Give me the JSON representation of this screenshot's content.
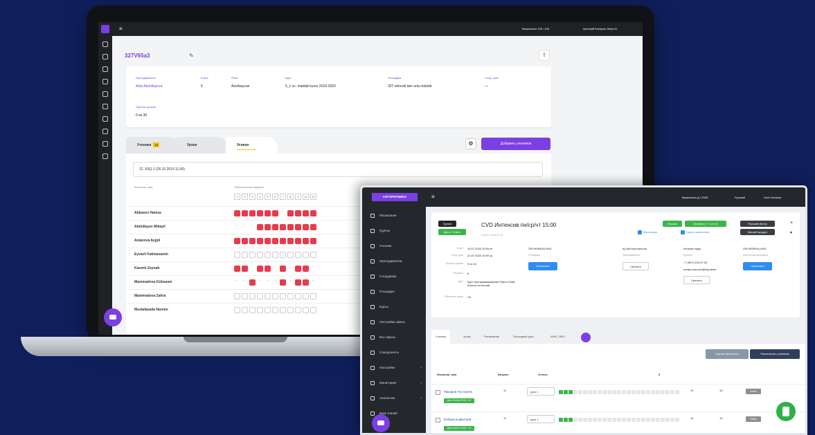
{
  "laptop": {
    "topbar": {
      "menu_icon": "hamburger-icon",
      "branch": "Вершинита 196 / 108",
      "user": "Артемий Бонарик Омер Ш"
    },
    "group_title": "327V65a3",
    "info": [
      {
        "label": "Преподаватель",
        "value": "Aida Abdullayeva",
        "link": true
      },
      {
        "label": "Класс",
        "value": "5",
        "link": false
      },
      {
        "label": "Язык",
        "value": "Azerbaycan",
        "link": false
      },
      {
        "label": "Курс",
        "value": "5_1 sc. maktab kursu 2019-2020",
        "link": false
      },
      {
        "label": "Площадка",
        "value": "327 nömrəli tam orta məktəb",
        "link": false
      },
      {
        "label": "След. урок",
        "value": "—",
        "link": false
      }
    ],
    "info2": {
      "label": "Прошло уроков",
      "value": "0 из 30"
    },
    "tabs": [
      {
        "label": "Ученики",
        "badge": "16"
      },
      {
        "label": "Уроки"
      },
      {
        "label": "Успехи"
      }
    ],
    "add_button": "Добавить учеников",
    "lesson_select": "12. КSQ 1 (26.10.2019 11:00)",
    "col_name": "Фамилия, имя",
    "col_required": "Обязательные задания",
    "task_numbers": [
      "1",
      "2",
      "3",
      "4",
      "5",
      "6",
      "7",
      "8",
      "9",
      "10",
      "11"
    ],
    "students": [
      {
        "name": "Abbasov Hamza",
        "marks": "rrrrrrdrrrr"
      },
      {
        "name": "Abdullayev Mikayil",
        "marks": "dddrrrrrrrr"
      },
      {
        "name": "Aslanova Aygül",
        "marks": "rrrrrrrrrrr"
      },
      {
        "name": "Eyvazli Fatimasanim",
        "marks": "eeeeeeeeeee"
      },
      {
        "name": "Kazımlı Zeynab",
        "marks": "rrdrrdrdrrd"
      },
      {
        "name": "Mammadova Gülsanım",
        "marks": "ddrdddrdrrd"
      },
      {
        "name": "Mammadova Zahra",
        "marks": "eeeeeeeeeee"
      },
      {
        "name": "Mustafazada Narmin",
        "marks": "eeeeeeeeeee"
      }
    ]
  },
  "overlay": {
    "logo": "АЛГОРИТМИКА",
    "topbar": {
      "branch": "Вершинита Д / 2006",
      "lang": "Русский",
      "user": "Олег Котиков"
    },
    "sidebar": [
      {
        "label": "Расписание",
        "icon": "clock-icon"
      },
      {
        "label": "Группы",
        "icon": "flag-icon"
      },
      {
        "label": "Ученики",
        "icon": "user-icon"
      },
      {
        "label": "Преподаватели",
        "icon": "teacher-icon"
      },
      {
        "label": "Сотрудники",
        "icon": "staff-icon"
      },
      {
        "label": "Площадки",
        "icon": "building-icon"
      },
      {
        "label": "Курсы",
        "icon": "book-icon"
      },
      {
        "label": "Настройки офиса",
        "icon": "office-icon"
      },
      {
        "label": "Все офисы",
        "icon": "offices-icon"
      },
      {
        "label": "Спецпроекты",
        "icon": "special-icon"
      },
      {
        "label": "Настройки",
        "icon": "gear-icon",
        "arrow": "›"
      },
      {
        "label": "Мониторинг",
        "icon": "monitor-icon",
        "arrow": "›"
      },
      {
        "label": "Аналитика",
        "icon": "analytics-icon",
        "arrow": "›"
      },
      {
        "label": "База знаний",
        "icon": "knowledge-icon"
      }
    ],
    "card": {
      "status_tag": "Группа",
      "group_tag": "Дети / Online",
      "title": "CVD Интенсив пн/ср/чт 15:00",
      "subtitle": "Python Start 6-10",
      "flags": [
        "Москва",
        "Активных + 4 из 24"
      ],
      "dark_tags": [
        "Русский (Бета)",
        "Мягкий продукт"
      ],
      "check1": "Мягкотрам",
      "check2": "Группа заполнена",
      "details": [
        {
          "label": "Старт",
          "value": "10.07.2020 15:00 вт"
        },
        {
          "label": "След. урок",
          "value": "22.07.2020 15:00 ср"
        },
        {
          "label": "Прошло уроков",
          "value": "0 из 16"
        },
        {
          "label": "Учеников",
          "value": "8"
        },
        {
          "label": "Курс",
          "value": "Курс программирования Python Start: Билеты интенсив"
        },
        {
          "label": "Объектная связь",
          "value": "ЧЗ"
        }
      ],
      "columns": [
        {
          "title": "ПФ-НИЗИНА-МЧ3",
          "label": "Площадка",
          "btn": "Назначить",
          "btn_type": "blue"
        },
        {
          "title": "Ку-Ми Мыслина.ва",
          "label": "Преподаватель",
          "btn": "Сменить",
          "btn_type": "white"
        },
        {
          "title": "Итомов Надя",
          "label": "Куратор",
          "extra": "+7 (967) 200-07-00",
          "extra2": "nadya.nasonov@bsg.team",
          "btn": "Сменить",
          "btn_type": "white"
        },
        {
          "title": "ПФ-НИЗИНА-МЧ3",
          "label": "Клиентский менеджер",
          "btn": "Назначить",
          "btn_type": "blue"
        }
      ]
    },
    "tabs": [
      "Ученики",
      "Уроки",
      "Расписание",
      "Последний урок",
      "WHC / BHC"
    ],
    "group_btn1": "Группа заполнена",
    "group_btn2": "Распечатать учеников",
    "table_headers": {
      "name": "Фамилия, имя",
      "age": "Возраст",
      "status": "Успехи",
      "col5": "5"
    },
    "rows": [
      {
        "name": "Макаров Постригин",
        "badge": "Дети-Online 2020 / 10",
        "age": "11",
        "select": "урок 1",
        "marks": "gggeeeeeeeeeeeeeeeeeeeeee",
        "n1": "16",
        "n2": "16",
        "tag": "Online"
      },
      {
        "name": "Бобриков Дмитрий",
        "badge": "Дети-Online 2020 / 10",
        "age": "11",
        "select": "урок 1",
        "marks": "gggeeeeeeeeeeeeeeeeeeeeee",
        "n1": "16",
        "n2": "16",
        "tag": "Online"
      }
    ],
    "page_text": "Ученики"
  }
}
